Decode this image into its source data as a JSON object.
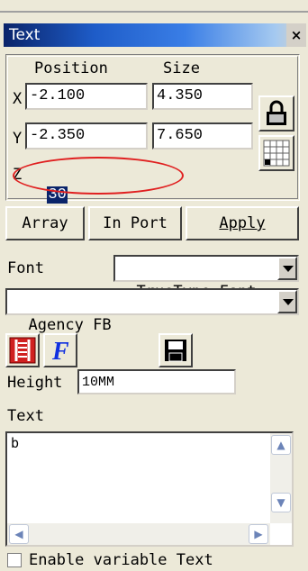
{
  "window": {
    "title": "Text",
    "close": "×"
  },
  "position": {
    "header_position": "Position",
    "header_size": "Size",
    "x_label": "X",
    "y_label": "Y",
    "z_label": "Z",
    "x_pos": "-2.100",
    "x_size": "4.350",
    "y_pos": "-2.350",
    "y_size": "7.650",
    "z_value": "30"
  },
  "buttons": {
    "array": "Array",
    "import": "In Port",
    "apply": "Apply"
  },
  "font": {
    "label": "Font",
    "type_value": "TrueType Font",
    "family_value": "Agency FB"
  },
  "height": {
    "label": "Height",
    "value": "10MM"
  },
  "text": {
    "label": "Text",
    "value": "b"
  },
  "variable": {
    "label": "Enable variable Text",
    "checked": false
  },
  "colors": {
    "title_start": "#0a246a",
    "title_end": "#a6caf0",
    "highlight": "#e02020",
    "face": "#ece9d8"
  }
}
